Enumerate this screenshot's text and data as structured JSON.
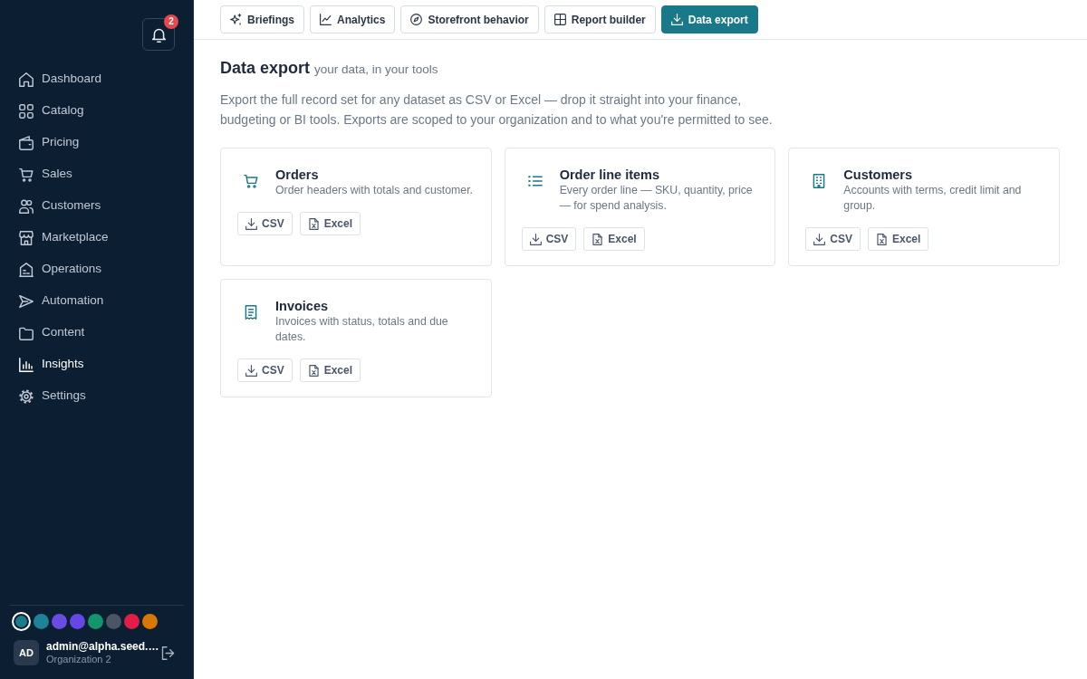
{
  "sidebar": {
    "notifications": {
      "badge": "2"
    },
    "nav": [
      {
        "label": "Dashboard",
        "selected": false
      },
      {
        "label": "Catalog",
        "selected": false
      },
      {
        "label": "Pricing",
        "selected": false
      },
      {
        "label": "Sales",
        "selected": false
      },
      {
        "label": "Customers",
        "selected": false
      },
      {
        "label": "Marketplace",
        "selected": false
      },
      {
        "label": "Operations",
        "selected": false
      },
      {
        "label": "Automation",
        "selected": false
      },
      {
        "label": "Content",
        "selected": false
      },
      {
        "label": "Insights",
        "selected": true
      },
      {
        "label": "Settings",
        "selected": false
      }
    ],
    "color_swatches": [
      {
        "color": "#1b7c8c",
        "selected": true
      },
      {
        "color": "#1f8296",
        "selected": false
      },
      {
        "color": "#6a4be3",
        "selected": false
      },
      {
        "color": "#6546e8",
        "selected": false
      },
      {
        "color": "#12966b",
        "selected": false
      },
      {
        "color": "#4b5565",
        "selected": false
      },
      {
        "color": "#e11d48",
        "selected": false
      },
      {
        "color": "#d97706",
        "selected": false
      }
    ],
    "user": {
      "initials": "AD",
      "email": "admin@alpha.seed.…",
      "organization": "Organization 2"
    }
  },
  "toolbar": {
    "tabs": [
      {
        "label": "Briefings",
        "selected": false
      },
      {
        "label": "Analytics",
        "selected": false
      },
      {
        "label": "Storefront behavior",
        "selected": false
      },
      {
        "label": "Report builder",
        "selected": false
      },
      {
        "label": "Data export",
        "selected": true
      }
    ]
  },
  "header": {
    "title": "Data export",
    "subtitle": "your data, in your tools",
    "description": "Export the full record set for any dataset as CSV or Excel — drop it straight into your finance, budgeting or BI tools. Exports are scoped to your organization and to what you're permitted to see."
  },
  "datasets": [
    {
      "title": "Orders",
      "description": "Order headers with totals and customer.",
      "buttons": [
        {
          "kind": "csv",
          "label": "CSV"
        },
        {
          "kind": "excel",
          "label": "Excel"
        }
      ]
    },
    {
      "title": "Order line items",
      "description": "Every order line — SKU, quantity, price — for spend analysis.",
      "buttons": [
        {
          "kind": "csv",
          "label": "CSV"
        },
        {
          "kind": "excel",
          "label": "Excel"
        }
      ]
    },
    {
      "title": "Customers",
      "description": "Accounts with terms, credit limit and group.",
      "buttons": [
        {
          "kind": "csv",
          "label": "CSV"
        },
        {
          "kind": "excel",
          "label": "Excel"
        }
      ]
    },
    {
      "title": "Invoices",
      "description": "Invoices with status, totals and due dates.",
      "buttons": [
        {
          "kind": "csv",
          "label": "CSV"
        },
        {
          "kind": "excel",
          "label": "Excel"
        }
      ]
    }
  ]
}
